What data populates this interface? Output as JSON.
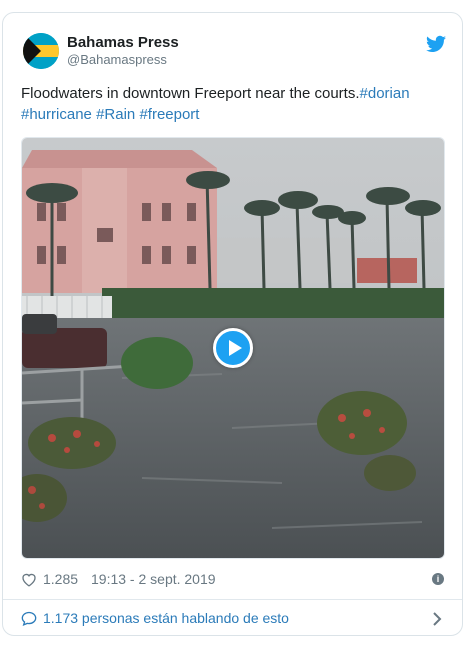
{
  "account": {
    "name": "Bahamas Press",
    "handle": "@Bahamaspress",
    "avatar_icon": "bahamas-flag-avatar"
  },
  "tweet": {
    "text": "Floodwaters in downtown Freeport near the courts.",
    "hashtags": [
      "#dorian",
      "#hurricane",
      "#Rain",
      "#freeport"
    ]
  },
  "media": {
    "type": "video",
    "icon": "play-icon",
    "description_colors": {
      "water": "#5b6063",
      "sky": "#c9ccce",
      "building": "#d9a6a0"
    }
  },
  "meta": {
    "likes": "1.285",
    "timestamp": "19:13 - 2 sept. 2019"
  },
  "footer": {
    "talking": "1.173 personas están hablando de esto"
  },
  "colors": {
    "link": "#2b7bb9",
    "twitter_blue": "#1da1f2",
    "muted": "#697882",
    "border": "#dbe3e8"
  }
}
